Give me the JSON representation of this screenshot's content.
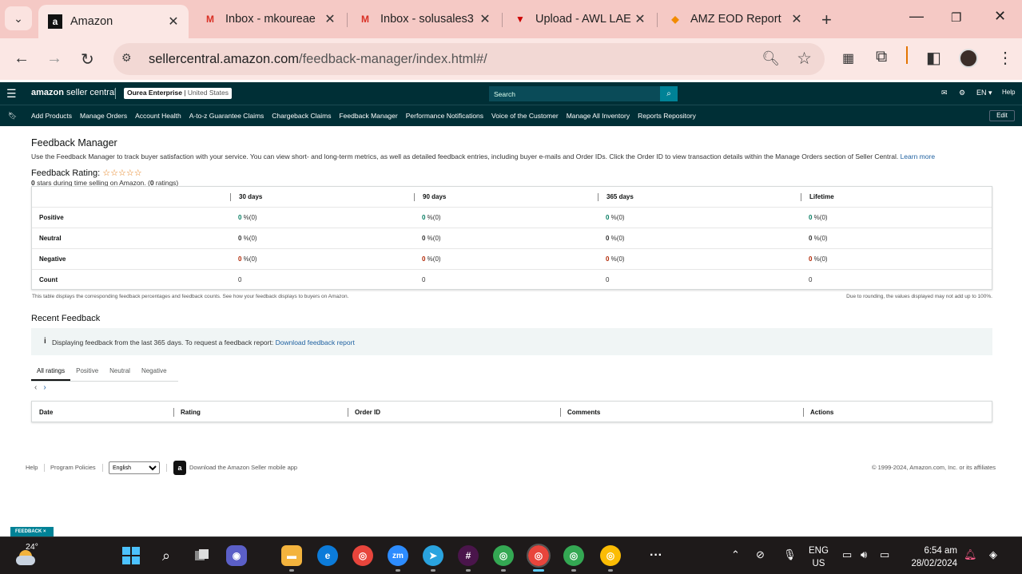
{
  "browser": {
    "tabs": [
      {
        "title": "Amazon",
        "favicon": "amazon-icon",
        "active": true
      },
      {
        "title": "Inbox - mkoureae",
        "favicon": "gmail-icon",
        "active": false
      },
      {
        "title": "Inbox - solusales3",
        "favicon": "gmail-icon",
        "active": false
      },
      {
        "title": "Upload - AWL LAE",
        "favicon": "upload-icon",
        "active": false
      },
      {
        "title": "AMZ EOD Report",
        "favicon": "report-icon",
        "active": false
      }
    ],
    "url_domain": "sellercentral.amazon.com",
    "url_path": "/feedback-manager/index.html#/"
  },
  "header": {
    "logo_main": "amazon",
    "logo_sub": "seller central",
    "store_name": "Ourea Enterprise",
    "store_region": "United States",
    "search_placeholder": "Search",
    "language": "EN",
    "help": "Help"
  },
  "nav": {
    "items": [
      "Add Products",
      "Manage Orders",
      "Account Health",
      "A-to-z Guarantee Claims",
      "Chargeback Claims",
      "Feedback Manager",
      "Performance Notifications",
      "Voice of the Customer",
      "Manage All Inventory",
      "Reports Repository"
    ],
    "edit_label": "Edit"
  },
  "page": {
    "title": "Feedback Manager",
    "description": "Use the Feedback Manager to track buyer satisfaction with your service. You can view short- and long-term metrics, as well as detailed feedback entries, including buyer e-mails and Order IDs. Click the Order ID to view transaction details within the Manage Orders section of Seller Central.",
    "learn_more": "Learn more",
    "rating_label": "Feedback Rating:",
    "rating_stars": "☆☆☆☆☆",
    "rating_count_stars": "0",
    "rating_sub_mid": " stars during time selling on Amazon. (",
    "rating_count": "0",
    "rating_sub_end": " ratings)"
  },
  "feedback_table": {
    "columns": [
      "30 days",
      "90 days",
      "365 days",
      "Lifetime"
    ],
    "rows": [
      {
        "label": "Positive",
        "values": [
          "0",
          "0",
          "0",
          "0"
        ],
        "suffix": " %(0)",
        "tone": "green"
      },
      {
        "label": "Neutral",
        "values": [
          "0",
          "0",
          "0",
          "0"
        ],
        "suffix": " %(0)",
        "tone": "plain"
      },
      {
        "label": "Negative",
        "values": [
          "0",
          "0",
          "0",
          "0"
        ],
        "suffix": " %(0)",
        "tone": "red"
      },
      {
        "label": "Count",
        "values": [
          "0",
          "0",
          "0",
          "0"
        ],
        "suffix": "",
        "tone": "none"
      }
    ],
    "note_left": "This table displays the corresponding feedback percentages and feedback counts. See how your feedback displays to buyers on Amazon.",
    "note_right": "Due to rounding, the values displayed may not add up to 100%."
  },
  "recent": {
    "title": "Recent Feedback",
    "info_text": "Displaying feedback from the last 365 days. To request a feedback report:",
    "info_link": "Download feedback report",
    "tabs": [
      "All ratings",
      "Positive",
      "Neutral",
      "Negative"
    ],
    "columns": [
      "Date",
      "Rating",
      "Order ID",
      "Comments",
      "Actions"
    ]
  },
  "footer": {
    "help": "Help",
    "program_policies": "Program Policies",
    "language_selected": "English",
    "app_text": "Download the Amazon Seller mobile app",
    "copyright": "© 1999-2024, Amazon.com, Inc. or its affiliates"
  },
  "feedback_chip": "FEEDBACK",
  "taskbar": {
    "temperature": "24°",
    "lang_line1": "ENG",
    "lang_line2": "US",
    "time": "6:54 am",
    "date": "28/02/2024"
  }
}
